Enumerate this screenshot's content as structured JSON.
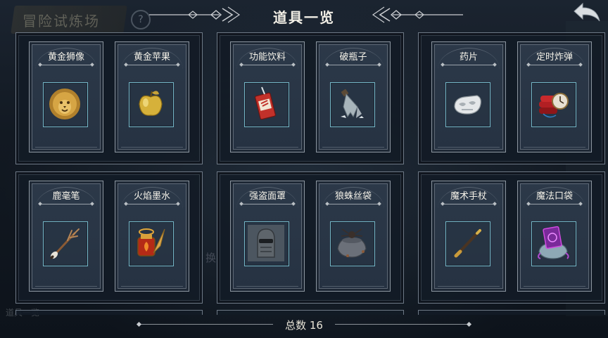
{
  "header": {
    "title": "道具一览"
  },
  "background": {
    "sign_text": "冒险试炼场",
    "help": "?",
    "corner_label": "道具一览",
    "side_text": "换"
  },
  "groups": [
    {
      "items": [
        {
          "name": "黄金狮像",
          "icon": "golden-lion-icon"
        },
        {
          "name": "黄金苹果",
          "icon": "golden-apple-icon"
        }
      ]
    },
    {
      "items": [
        {
          "name": "功能饮料",
          "icon": "energy-drink-icon"
        },
        {
          "name": "破瓶子",
          "icon": "broken-bottle-icon"
        }
      ]
    },
    {
      "items": [
        {
          "name": "药片",
          "icon": "pill-icon"
        },
        {
          "name": "定时炸弹",
          "icon": "time-bomb-icon"
        }
      ]
    },
    {
      "items": [
        {
          "name": "鹿毫笔",
          "icon": "antler-brush-icon"
        },
        {
          "name": "火焰墨水",
          "icon": "flame-ink-icon"
        }
      ]
    },
    {
      "items": [
        {
          "name": "强盗面罩",
          "icon": "bandit-mask-icon"
        },
        {
          "name": "狼蛛丝袋",
          "icon": "tarantula-bag-icon"
        }
      ]
    },
    {
      "items": [
        {
          "name": "魔术手杖",
          "icon": "magic-wand-icon"
        },
        {
          "name": "魔法口袋",
          "icon": "magic-pouch-icon"
        }
      ]
    }
  ],
  "footer": {
    "total": "总数 16"
  },
  "colors": {
    "accent": "#75b7c8",
    "panel": "#2c3949",
    "border": "#8c96a0"
  }
}
